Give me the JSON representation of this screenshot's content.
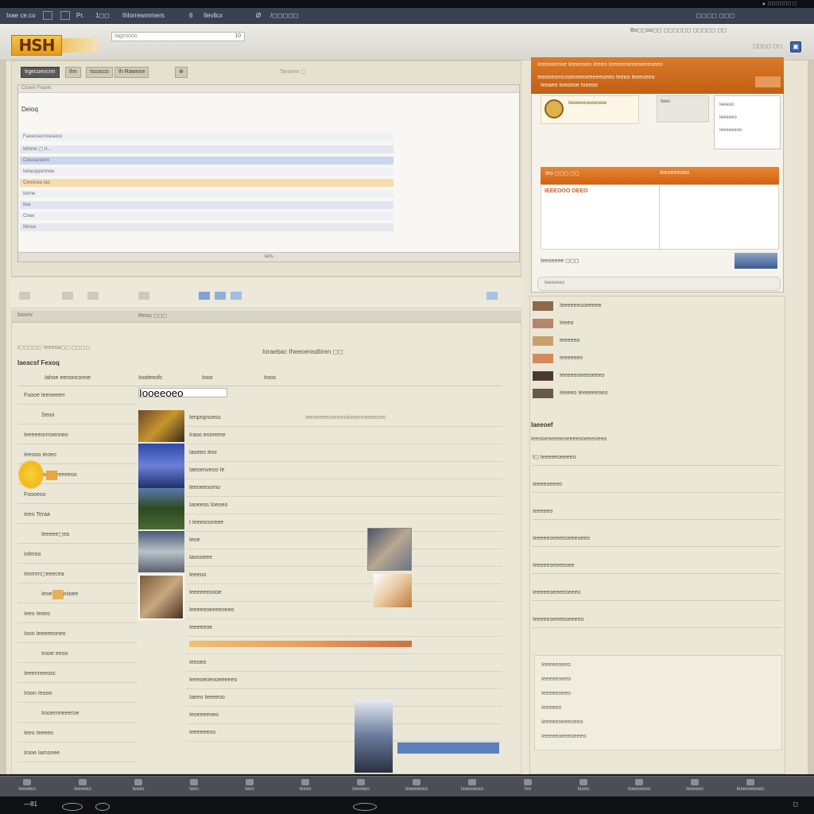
{
  "system": {
    "status": "▲ ◻◻◻◻◻◻ ◻"
  },
  "tabs": [
    "Ixae ce.co",
    "■",
    "☐",
    "Pr.",
    "1◻◻",
    "Ihlorrewmmers",
    "6",
    "Ilevllcx",
    "Ø",
    "/◻◻◻◻◻"
  ],
  "tabbar_right": "◻◻◻◻  ◻◻◻",
  "header": {
    "logo": "HSH",
    "search_placeholder": "Iagosooo",
    "search_go": "10",
    "links": "Bo◻◻oo◻◻  ◻◻◻◻◻◻ ◻◻◻◻◻  ◻◻",
    "links2": "◻◻◻◻  ◻◻",
    "button_icon": "▣"
  },
  "left_toolbar": {
    "buttons": [
      "Irgecuevcrm",
      "Ihn",
      "Iscocco",
      "Ih  Rawnne",
      "⊕"
    ],
    "hint": "Tanonw ◻"
  },
  "inner_window": {
    "bar": "Ciroerr Fraom",
    "title": "Deioq",
    "rows": [
      "Faoeosecnneaoco",
      "Iehtmn ◻ rr...",
      "Ceiusansnm",
      "Ieilacqqumnee",
      "Ceocnea tas",
      "Iorme",
      "Iloe",
      "Crew",
      "Ihlnoo"
    ],
    "footer": "Iahs"
  },
  "left_tabs": [
    "Ioovrv",
    "Reou ◻◻◻"
  ],
  "left_section": {
    "header1": "I◻◻◻◻◻  Ieeeoa◻◻  ◻◻◻◻",
    "header2": "Iaeacsf Fexoq",
    "center_title": "Ioraebac  Iheeoensdtiren ◻◻",
    "col_heads": [
      "Iahoe eenonconne",
      "Iooiteeofc",
      "Iooo",
      "Irooc"
    ],
    "left_rows": [
      "Foooe  Ieeneeerr",
      "Seoo",
      "Ieeeeeorrroenneo",
      "Ieeooo  Ieoeo",
      "Iaoo  Ieeeeeoo",
      "Foooeoo",
      "Ieeo Teraa",
      "Ieeeee◻ea",
      "Ioleroo",
      "Ieomrn◻eeecea",
      "Ieoeeeonnioee",
      "Ieeo  Ieoeo",
      "Iooo  Ieeeeeoneo",
      "Irooe  eeoo",
      "Ieeenneeosc",
      "Iroon  Ieooo",
      "Irooemneeeroe",
      "Ieeo  Ieeeeo",
      "Irooe  Iamonee"
    ],
    "center_rows": [
      [
        "Ienpnpnoesc",
        "Ieeoeeeeoonnnniiooenneeeecec"
      ],
      [
        "Iraoo eooreme",
        ""
      ],
      [
        "Iaseeo Ieor",
        ""
      ],
      [
        "Iaeoenveoo Ie",
        ""
      ],
      [
        "Ieeoeeoomo",
        ""
      ],
      [
        "Iaoeeos  Ioeoeo",
        ""
      ],
      [
        "I  Ieeeonoreee",
        ""
      ],
      [
        "Ieoe",
        ""
      ],
      [
        "Iaoooeee",
        ""
      ],
      [
        "Ieeeoo",
        ""
      ],
      [
        "Ieeeeeeoooe",
        ""
      ],
      [
        "Ieeeeeoeeeeoeeo",
        ""
      ],
      [
        "Ieeeeeoe",
        ""
      ],
      [
        "Ieeoeoo",
        "Ieeoeeeeeeoeoeeoeeo"
      ],
      [
        "Ieeoeo",
        ""
      ],
      [
        "Ieeeoeoeooeeeeeo",
        ""
      ],
      [
        "Iaeeo  Ieeeeoo",
        ""
      ],
      [
        "Ieoeeeeoeo",
        ""
      ],
      [
        "Ieeeeeeoo",
        ""
      ]
    ],
    "filter_value": "Iooeeoeo"
  },
  "right_top": {
    "head1": "Ieeeoonnoe  Ieeeeoeo  Ieeeo  Ieeeeeoeeeoeeeoeeo",
    "head2": "Ieeooeomcnoeoeeoeeeeeoeeo  Ieeeo  Ieeeoeeo",
    "head3": "Ieoaeo  Ioeoeoe  Ioeeoe",
    "card1": "Ieeeeeeoeeeoeee",
    "card2": "Ieeo",
    "box_lines": [
      "Ieeeoo",
      "Ieeeeeo",
      "Ieeeeeeoo"
    ],
    "orange_text": "Ieo ◻◻◻ ◻◻",
    "orange_right": "Ieeoeeeoeo",
    "lower_left": "IEEEOOO OEEO",
    "footer_text": "Ieeoeeee  ◻◻◻",
    "bottom_text": "Ieeeeeeo"
  },
  "right_list": {
    "items": [
      "Ieeeeeeooeeeee",
      "Ieeeo",
      "Ieeeeeo",
      "Ieeeeeeo",
      "Ieeeeeoeeeoeeeo",
      "Ieeeeo  Ieeeeeeoeo"
    ],
    "section_title": "Iaeeoef",
    "section_sub": "Ieeooeoeeeeoeeeeooeeeoeeo",
    "lines": [
      "I◻ Ieeeeeoeeeeo",
      "Ieeeeoeeeo",
      "Ieeeeeo",
      "Ieeeeeoeeeeoeeeoeeo",
      "Ieeeeeoeeeeoee",
      "Ieeeeeoeeeeoeeeo",
      "Ieeeeeoeeeeoeeeeo"
    ],
    "box_lines": [
      "Ieeeeeoeeo",
      "Ieeeeeoeeo",
      "Ieeeeeoeeo",
      "Ieeeeeo",
      "Ieeeeeoeeeoeeo",
      "Ieeeeeoeeeoeeeo"
    ]
  },
  "taskbar": [
    "Ieeeeeo",
    "Ieeeeeo",
    "Ieeeo",
    "Ieeo",
    "Ieeo",
    "Ieeeo",
    "Ieeeeeo",
    "Ieeeeeeeo",
    "Ieeeeeeeo",
    "Ieo",
    "Ieeeo",
    "Ieeeeeeeo",
    "Ieeeeeo",
    "Ieeeeeeeeeo"
  ],
  "bottombar": {
    "left": "—81",
    "right": "◻"
  }
}
